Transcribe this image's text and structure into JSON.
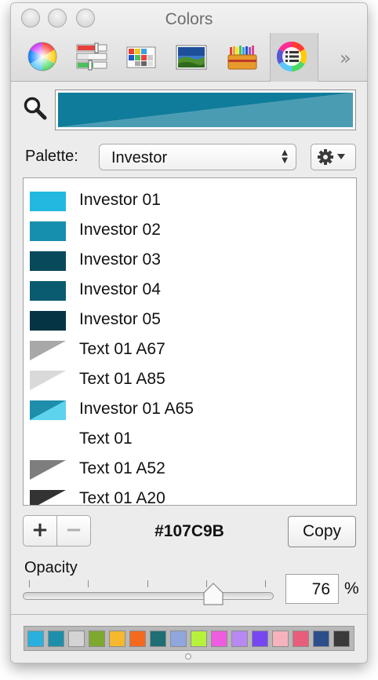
{
  "window": {
    "title": "Colors"
  },
  "toolbar": {
    "items": [
      {
        "icon": "color-wheel-icon"
      },
      {
        "icon": "color-sliders-icon"
      },
      {
        "icon": "color-palettes-icon"
      },
      {
        "icon": "image-palettes-icon"
      },
      {
        "icon": "crayons-icon"
      },
      {
        "icon": "palette-list-icon",
        "selected": true
      }
    ],
    "more_icon": "»"
  },
  "preview": {
    "current_color": "#107C9B",
    "previous_color": "#4A9CB3"
  },
  "palette": {
    "label": "Palette:",
    "selected": "Investor"
  },
  "colors": [
    {
      "label": "Investor 01",
      "color": "#22B8E0"
    },
    {
      "label": "Investor 02",
      "color": "#168FAE"
    },
    {
      "label": "Investor 03",
      "color": "#09495C"
    },
    {
      "label": "Investor 04",
      "color": "#0B5B70"
    },
    {
      "label": "Investor 05",
      "color": "#053544"
    },
    {
      "label": "Text 01 A67",
      "color": "#A8A8A8",
      "alpha": 0.67
    },
    {
      "label": "Text 01 A85",
      "color": "#D9D9D9",
      "alpha": 0.85
    },
    {
      "label": "Investor 01 A65",
      "color": "#5DD3EE",
      "base": "#1E8EAA",
      "alpha": 0.65
    },
    {
      "label": "Text 01",
      "color": "#FFFFFF"
    },
    {
      "label": "Text 01 A52",
      "color": "#7E7E7E",
      "alpha": 0.52
    },
    {
      "label": "Text 01 A20",
      "color": "#333333",
      "alpha": 0.2
    }
  ],
  "actions": {
    "add_label": "+",
    "remove_label": "−",
    "hex_value": "#107C9B",
    "copy_label": "Copy"
  },
  "opacity": {
    "label": "Opacity",
    "value": "76",
    "percent_symbol": "%",
    "level": 0.76
  },
  "swatch_tray": [
    "#2AB0DE",
    "#1E8EAA",
    "#D4D4D4",
    "#7DAA2E",
    "#F5B82E",
    "#F36A1F",
    "#1E6E73",
    "#8FA7DC",
    "#B6F23B",
    "#F05CE0",
    "#B889F2",
    "#7747F2",
    "#F6B3BE",
    "#E85E7A",
    "#2C4F8C",
    "#3A3A3A"
  ]
}
